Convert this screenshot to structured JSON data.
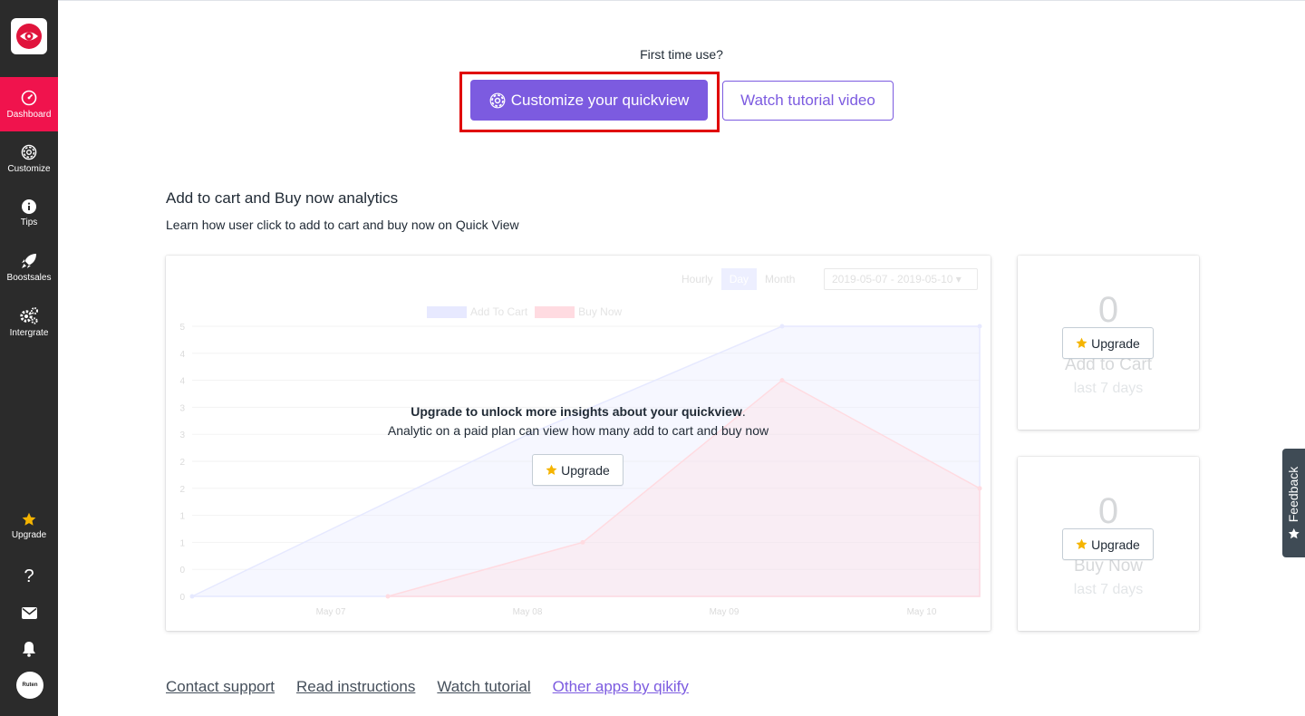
{
  "sidebar": {
    "logo_icon": "eye-icon",
    "items": [
      {
        "label": "Dashboard",
        "icon": "gauge-icon",
        "active": true
      },
      {
        "label": "Customize",
        "icon": "gear-icon"
      },
      {
        "label": "Tips",
        "icon": "info-icon"
      },
      {
        "label": "Boostsales",
        "icon": "rocket-icon"
      },
      {
        "label": "Intergrate",
        "icon": "gears-icon"
      }
    ],
    "upgrade_label": "Upgrade",
    "avatar_text": "Ruten"
  },
  "header": {
    "prompt": "First time use?",
    "customize_button": "Customize your quickview",
    "tutorial_button": "Watch tutorial video"
  },
  "analytics": {
    "title": "Add to cart and Buy now analytics",
    "subtitle": "Learn how user click to add to cart and buy now on Quick View",
    "range_tabs": [
      "Hourly",
      "Day",
      "Month"
    ],
    "selected_range": "Day",
    "date_range": "2019-05-07 - 2019-05-10",
    "locked_title": "Upgrade to unlock more insights about your quickview",
    "locked_title_suffix": ".",
    "locked_subtitle": "Analytic on a paid plan can view how many add to cart and buy now",
    "upgrade_label": "Upgrade"
  },
  "chart_data": {
    "type": "area",
    "categories": [
      "May 07",
      "May 08",
      "May 09",
      "May 10"
    ],
    "series": [
      {
        "name": "Add To Cart",
        "color": "#7b88ff",
        "values": [
          0,
          3,
          5,
          5
        ]
      },
      {
        "name": "Buy Now",
        "color": "#ff3b5c",
        "values": [
          0,
          1,
          4,
          2
        ]
      }
    ],
    "yticks": [
      "0",
      "0",
      "1",
      "1",
      "2",
      "2",
      "3",
      "3",
      "4",
      "4",
      "5"
    ],
    "ylim": [
      0,
      5
    ]
  },
  "stats": [
    {
      "value": "0",
      "label": "Add to Cart",
      "period": "last 7 days",
      "upgrade_label": "Upgrade"
    },
    {
      "value": "0",
      "label": "Buy Now",
      "period": "last 7 days",
      "upgrade_label": "Upgrade"
    }
  ],
  "footer": {
    "links": [
      "Contact support",
      "Read instructions",
      "Watch tutorial",
      "Other apps by qikify"
    ]
  },
  "feedback": {
    "label": "Feedback"
  },
  "colors": {
    "accent": "#7c5be0",
    "sidebar": "#2b2b2b",
    "active": "#f0134d",
    "star": "#f5b400"
  }
}
